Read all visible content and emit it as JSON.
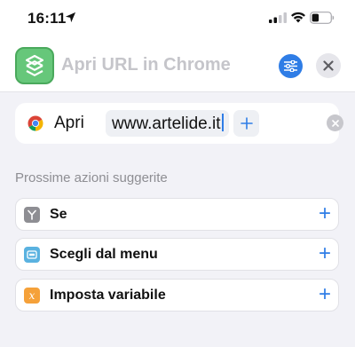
{
  "status_bar": {
    "time": "16:11",
    "icons": [
      "location-arrow-icon",
      "cellular-signal-icon",
      "wifi-icon",
      "battery-icon"
    ]
  },
  "header": {
    "title": "Apri URL in Chrome",
    "app_icon": "shortcuts-app-icon",
    "settings_icon": "sliders-icon",
    "close_icon": "close-icon",
    "accent_color": "#2f7de6",
    "app_icon_color": "#66c77a"
  },
  "action": {
    "app_icon": "chrome-icon",
    "verb": "Apri",
    "url_value": "www.artelide.it",
    "add_icon": "plus-icon",
    "clear_icon": "clear-icon"
  },
  "suggestions": {
    "title": "Prossime azioni suggerite",
    "items": [
      {
        "label": "Se",
        "icon": "branch-icon",
        "color": "#8e8e93"
      },
      {
        "label": "Scegli dal menu",
        "icon": "menu-icon",
        "color": "#5ab2e0"
      },
      {
        "label": "Imposta variabile",
        "icon": "variable-icon",
        "color": "#f5a13a"
      }
    ],
    "add_icon": "plus-icon"
  }
}
